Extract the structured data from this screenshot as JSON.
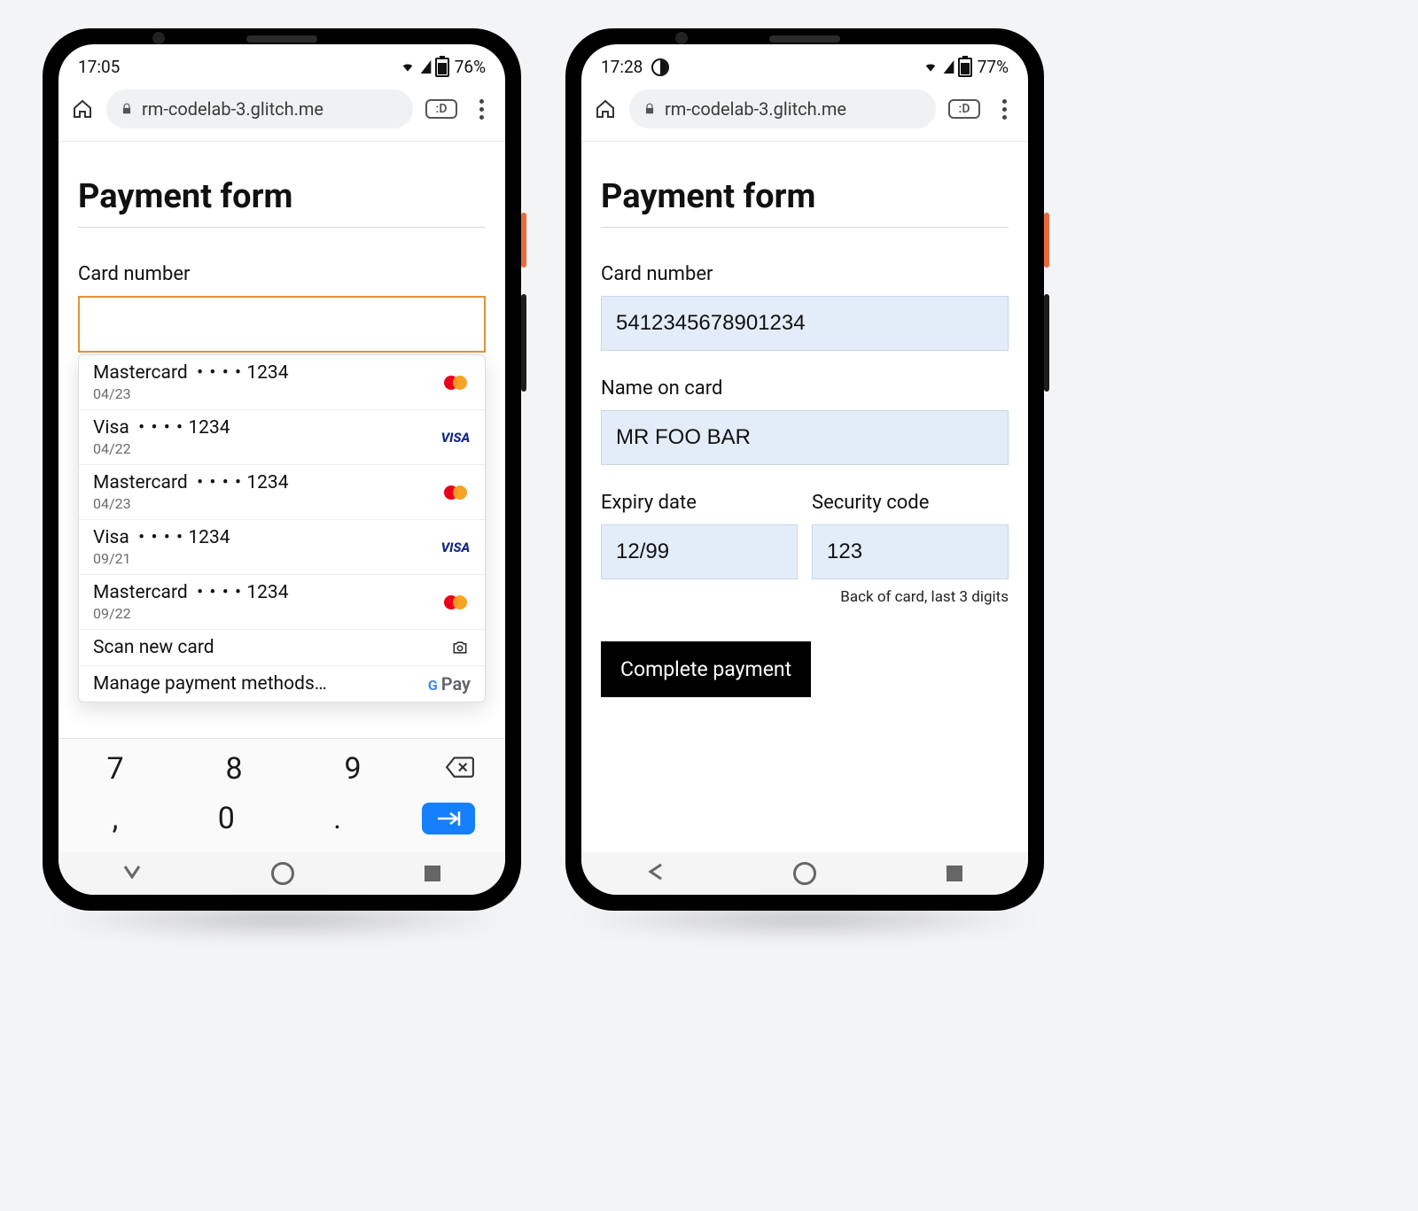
{
  "left": {
    "status": {
      "time": "17:05",
      "battery": "76%"
    },
    "url": "rm-codelab-3.glitch.me",
    "tab_count": ":D",
    "page_title": "Payment form",
    "card_number_label": "Card number",
    "card_number_value": "",
    "autofill": {
      "cards": [
        {
          "brand": "Mastercard",
          "last4": "1234",
          "exp": "04/23",
          "logo": "mastercard"
        },
        {
          "brand": "Visa",
          "last4": "1234",
          "exp": "04/22",
          "logo": "visa"
        },
        {
          "brand": "Mastercard",
          "last4": "1234",
          "exp": "04/23",
          "logo": "mastercard"
        },
        {
          "brand": "Visa",
          "last4": "1234",
          "exp": "09/21",
          "logo": "visa"
        },
        {
          "brand": "Mastercard",
          "last4": "1234",
          "exp": "09/22",
          "logo": "mastercard"
        }
      ],
      "scan_label": "Scan new card",
      "manage_label": "Manage payment methods…"
    },
    "keypad": {
      "row1": [
        "7",
        "8",
        "9"
      ],
      "row2": [
        ",",
        "0",
        "."
      ]
    }
  },
  "right": {
    "status": {
      "time": "17:28",
      "battery": "77%"
    },
    "url": "rm-codelab-3.glitch.me",
    "tab_count": ":D",
    "page_title": "Payment form",
    "card_number_label": "Card number",
    "card_number_value": "5412345678901234",
    "name_label": "Name on card",
    "name_value": "MR FOO BAR",
    "expiry_label": "Expiry date",
    "expiry_value": "12/99",
    "cvc_label": "Security code",
    "cvc_value": "123",
    "cvc_hint": "Back of card, last 3 digits",
    "submit_label": "Complete payment"
  }
}
